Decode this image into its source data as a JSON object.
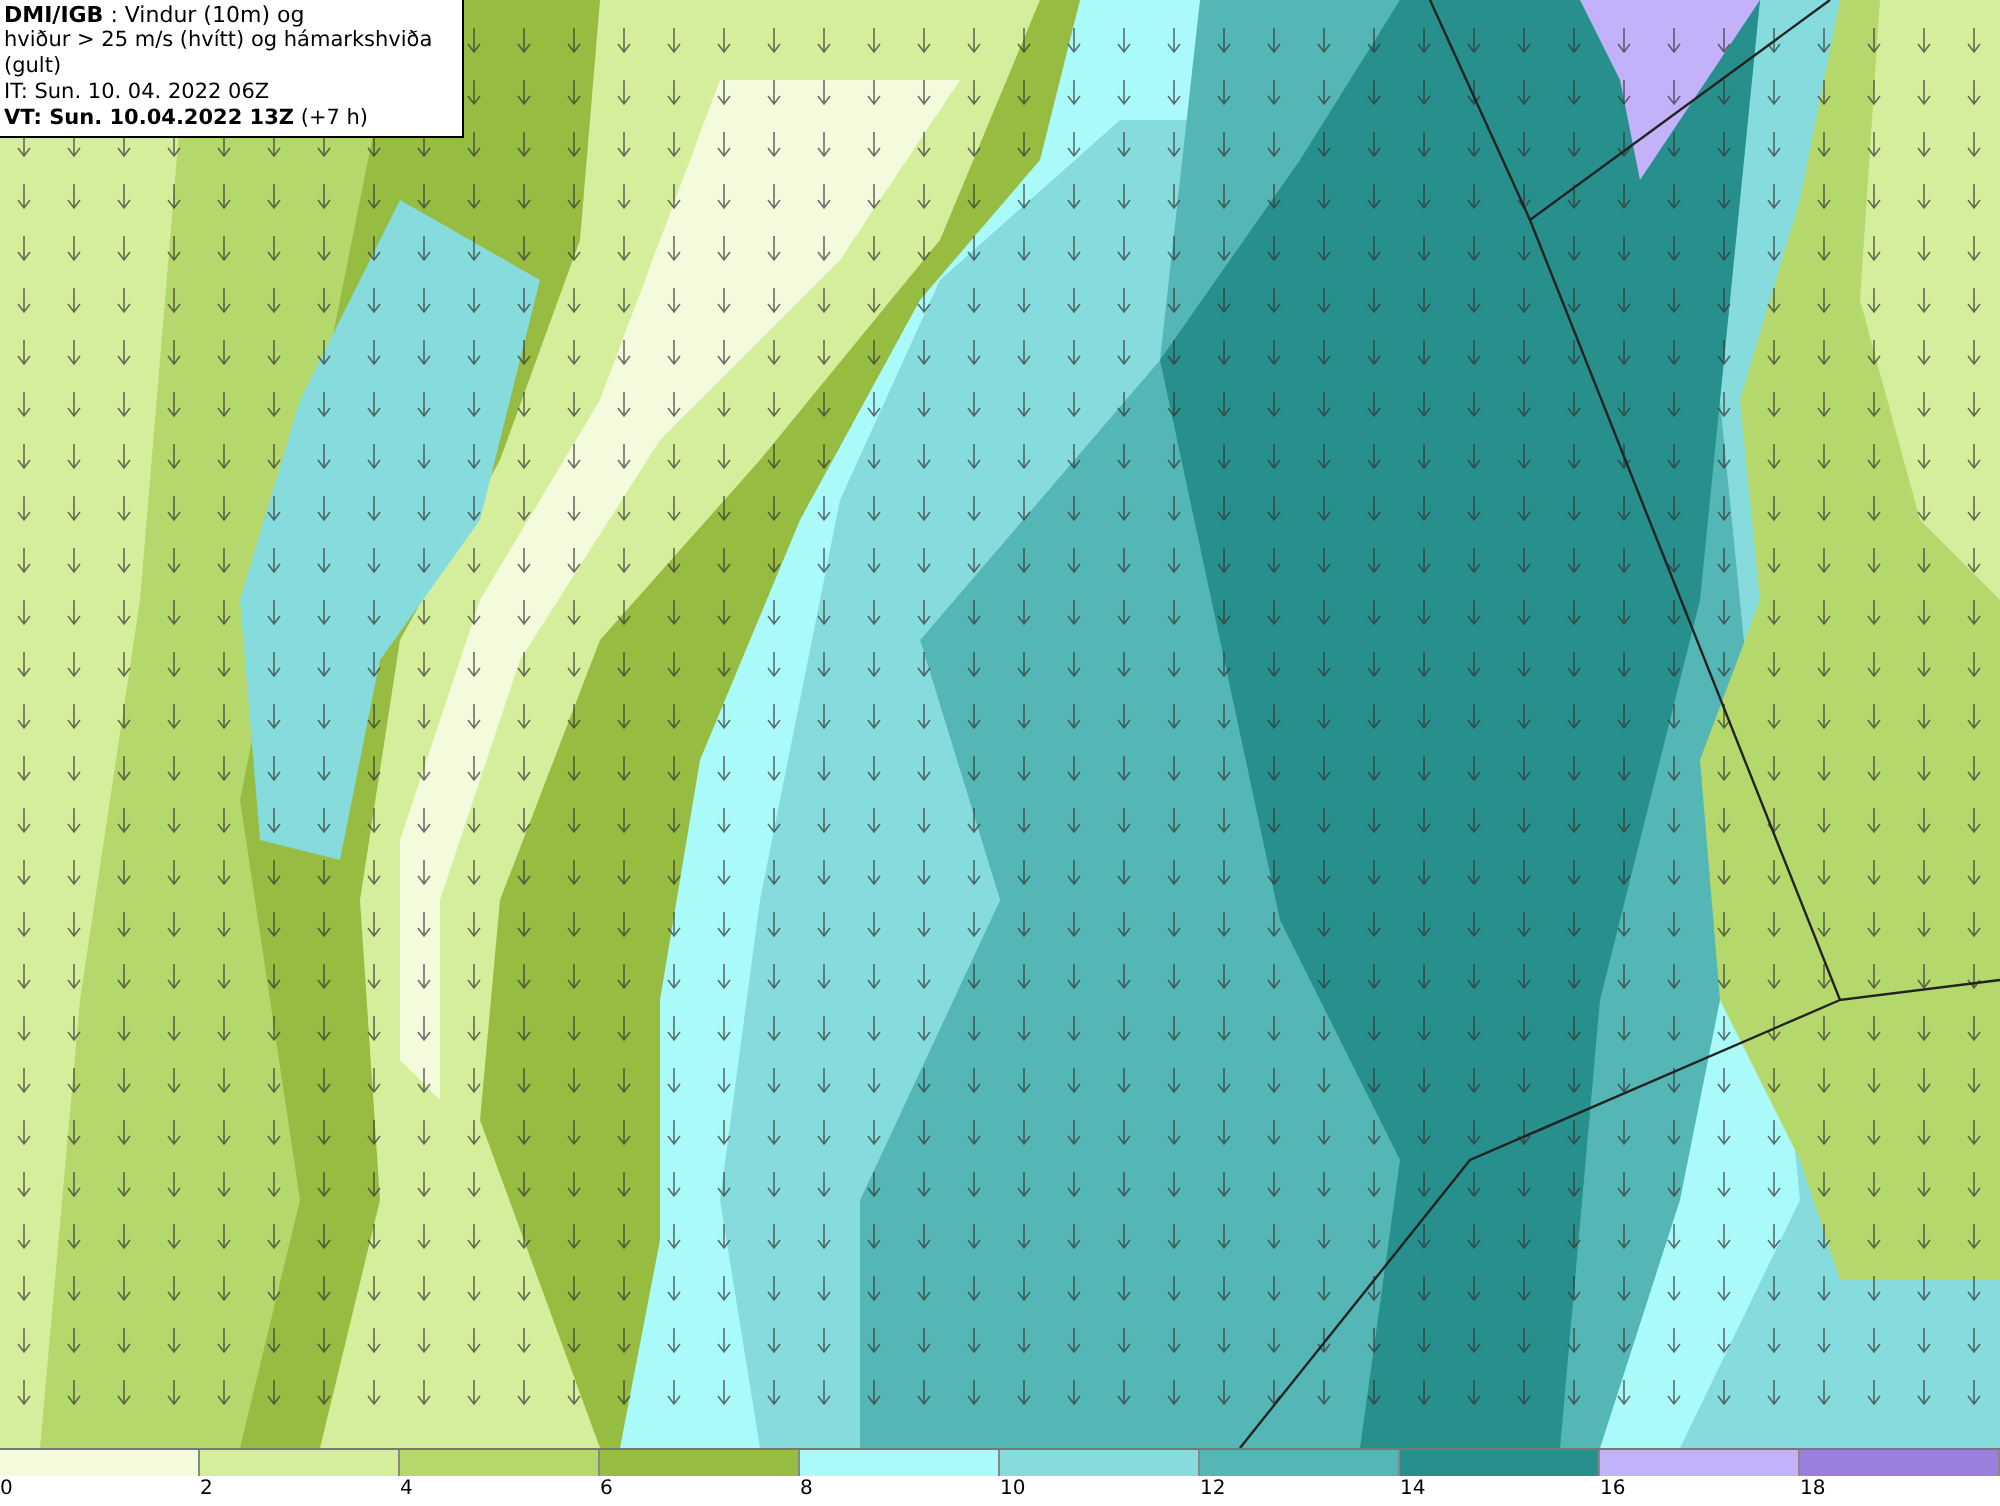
{
  "info_box": {
    "title": "**DMI/IGB** : Vindur (10m) og",
    "subtitle": "hviður > 25 m/s (hvítt) og hámarkshviða (gult)",
    "issue_time": "IT: Sun. 10. 04. 2022 06Z",
    "valid_time": "**VT: Sun. 10.04.2022 13Z** (+7 h)"
  },
  "legend": {
    "swatches": [
      {
        "color": "#f4fadc"
      },
      {
        "color": "#d5ee9c"
      },
      {
        "color": "#b5d86c"
      },
      {
        "color": "#96bd42"
      },
      {
        "color": "#aafafa"
      },
      {
        "color": "#86dcdc"
      },
      {
        "color": "#55b7b5"
      },
      {
        "color": "#278f8c"
      },
      {
        "color": "#c3b2fa"
      },
      {
        "color": "#9a7fdc"
      }
    ],
    "ticks": [
      "0",
      "2",
      "4",
      "6",
      "8",
      "10",
      "12",
      "14",
      "16",
      "18"
    ]
  }
}
